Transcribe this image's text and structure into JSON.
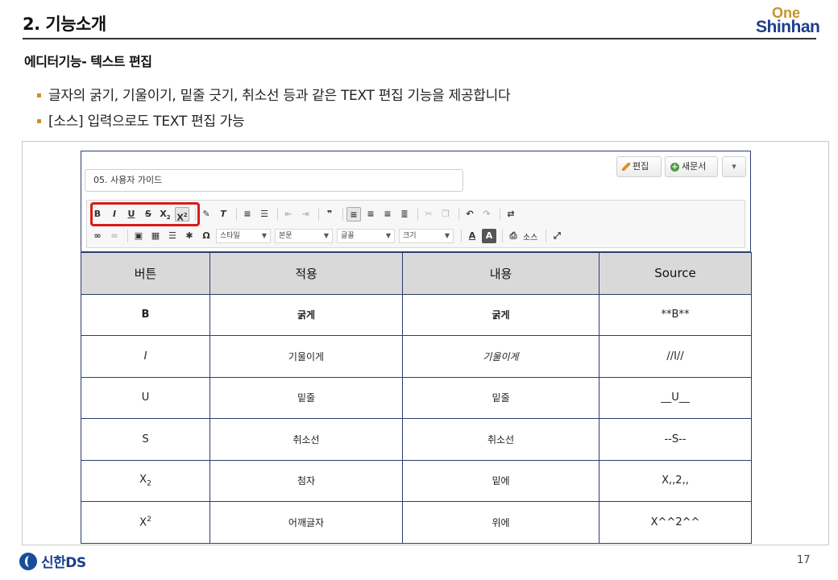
{
  "slide": {
    "title": "2. 기능소개",
    "logo_one": "One",
    "logo_shinhan": "Shinhan",
    "section_heading": "에디터기능- 텍스트 편집",
    "bullets": [
      "글자의 굵기, 기울이기, 밑줄 긋기, 취소선 등과 같은 TEXT 편집 기능을 제공합니다",
      "[소스] 입력으로도 TEXT 편집 가능"
    ],
    "footer_brand": "신한DS",
    "page_number": "17"
  },
  "editor": {
    "doc_title_value": "05. 사용자 가이드",
    "edit_button": "편집",
    "new_doc_button": "새문서",
    "more_icon": "chevron-down-icon",
    "combos": {
      "style": "스타일",
      "format": "본문",
      "font": "글꼴",
      "size": "크기"
    },
    "source_button": "소스",
    "text_color_label": "A",
    "bg_color_label": "A"
  },
  "table": {
    "headers": [
      "버튼",
      "적용",
      "내용",
      "Source"
    ],
    "rows": [
      {
        "button": "B",
        "apply": "굵게",
        "content": "굵게",
        "source": "**B**"
      },
      {
        "button": "I",
        "apply": "기울이게",
        "content": "기울이게",
        "source": "//I//"
      },
      {
        "button": "U",
        "apply": "밑줄",
        "content": "밑줄",
        "source": "__U__"
      },
      {
        "button": "S",
        "apply": "취소선",
        "content": "취소선",
        "source": "--S--"
      },
      {
        "button_base": "X",
        "button_script": "2",
        "apply": "첨자",
        "content": "밑에",
        "source": "X,,2,,"
      },
      {
        "button_base": "X",
        "button_script": "2",
        "apply": "어깨글자",
        "content": "위에",
        "source": "X^^2^^"
      }
    ]
  },
  "colors": {
    "accent_gold": "#c8922a",
    "brand_blue": "#1c3f8c",
    "highlight_red": "#d81b1b",
    "table_border": "#2c3e6e",
    "header_gray": "#d9d9d9"
  }
}
